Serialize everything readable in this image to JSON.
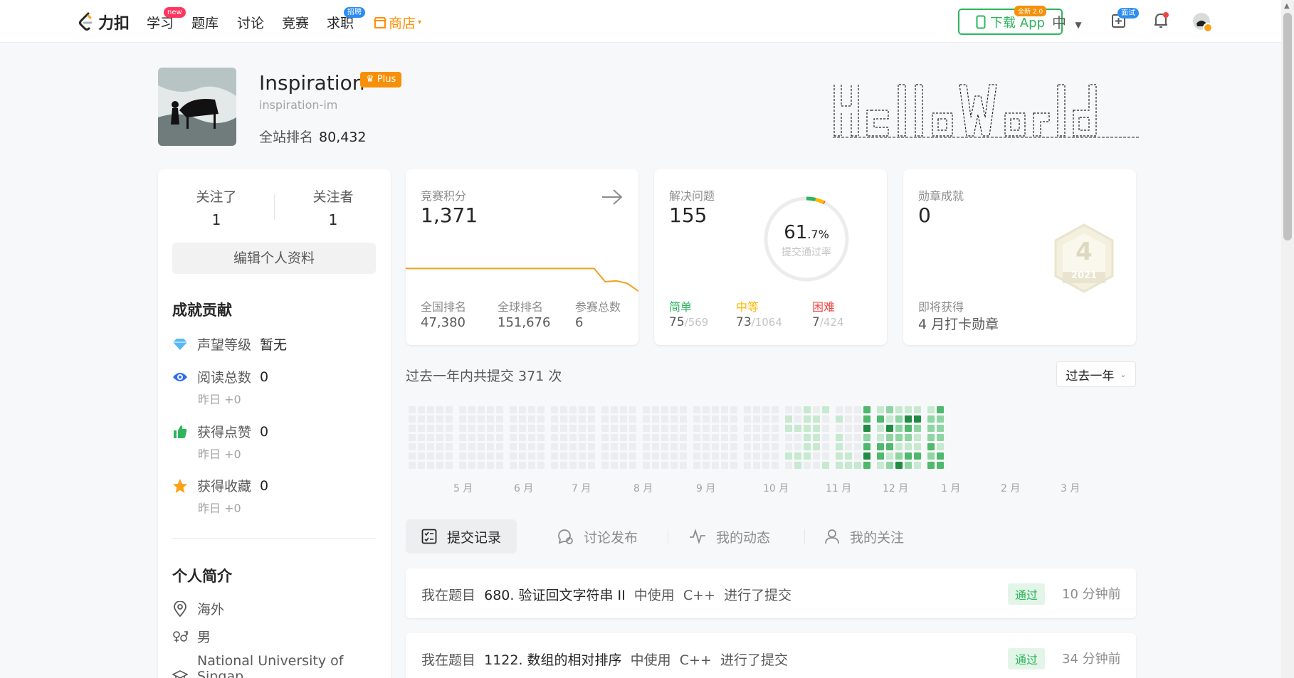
{
  "nav": {
    "logo": "力扣",
    "items": [
      {
        "label": "学习",
        "badge": "new"
      },
      {
        "label": "题库"
      },
      {
        "label": "讨论"
      },
      {
        "label": "竞赛"
      },
      {
        "label": "求职",
        "badge": "招聘"
      },
      {
        "label": "商店"
      }
    ],
    "download_label": "下载 App",
    "download_badge": "全新 2.0",
    "lang": "中",
    "interview_badge": "面试"
  },
  "profile": {
    "name": "Inspiration",
    "plus": "Plus",
    "slug": "inspiration-im",
    "rank_label": "全站排名",
    "rank_value": "80,432",
    "banner_text": "HelloWorld"
  },
  "sidebar": {
    "following_label": "关注了",
    "following_value": "1",
    "followers_label": "关注者",
    "followers_value": "1",
    "edit_label": "编辑个人资料",
    "achievements_title": "成就贡献",
    "rep_label": "声望等级",
    "rep_value": "暂无",
    "reads_label": "阅读总数",
    "reads_value": "0",
    "reads_sub": "昨日 +0",
    "likes_label": "获得点赞",
    "likes_value": "0",
    "likes_sub": "昨日 +0",
    "favs_label": "获得收藏",
    "favs_value": "0",
    "favs_sub": "昨日 +0",
    "bio_title": "个人简介",
    "location": "海外",
    "gender": "男",
    "school": "National University of Singap"
  },
  "contest": {
    "title": "竞赛积分",
    "rating": "1,371",
    "national_label": "全国排名",
    "national_value": "47,380",
    "global_label": "全球排名",
    "global_value": "151,676",
    "attended_label": "参赛总数",
    "attended_value": "6",
    "rating_history": [
      1371,
      1371,
      1371,
      1371,
      1371,
      1371,
      1371,
      1371,
      1371,
      1371,
      1371,
      1371,
      1371,
      1371,
      1371,
      1371,
      1371,
      1371,
      1340,
      1342,
      1336,
      1318
    ]
  },
  "solved": {
    "title": "解决问题",
    "total": "155",
    "rate_int": "61",
    "rate_dec": ".7%",
    "rate_label": "提交通过率",
    "easy_label": "简单",
    "easy_value": "75",
    "easy_total": "/569",
    "medium_label": "中等",
    "medium_value": "73",
    "medium_total": "/1064",
    "hard_label": "困难",
    "hard_value": "7",
    "hard_total": "/424",
    "colors": {
      "easy": "#2db55d",
      "medium": "#ffb800",
      "hard": "#ef4743"
    }
  },
  "badges": {
    "title": "勋章成就",
    "count": "0",
    "badge_number": "4",
    "badge_year": "2021",
    "upcoming_label": "即将获得",
    "upcoming_name": "4 月打卡勋章"
  },
  "heatmap": {
    "title": "过去一年内共提交 371 次",
    "range": "过去一年",
    "months": [
      "5 月",
      "6 月",
      "7 月",
      "8 月",
      "9 月",
      "10 月",
      "11 月",
      "12 月",
      "1 月",
      "2 月",
      "3 月"
    ]
  },
  "tabs": [
    {
      "label": "提交记录",
      "icon": "list-icon"
    },
    {
      "label": "讨论发布",
      "icon": "chat-icon"
    },
    {
      "label": "我的动态",
      "icon": "activity-icon"
    },
    {
      "label": "我的关注",
      "icon": "user-icon"
    }
  ],
  "submissions": [
    {
      "prefix": "我在题目",
      "problem": "680. 验证回文字符串 II",
      "mid": "中使用",
      "lang": "C++",
      "suffix": "进行了提交",
      "status": "通过",
      "time": "10 分钟前"
    },
    {
      "prefix": "我在题目",
      "problem": "1122. 数组的相对排序",
      "mid": "中使用",
      "lang": "C++",
      "suffix": "进行了提交",
      "status": "通过",
      "time": "34 分钟前"
    }
  ]
}
